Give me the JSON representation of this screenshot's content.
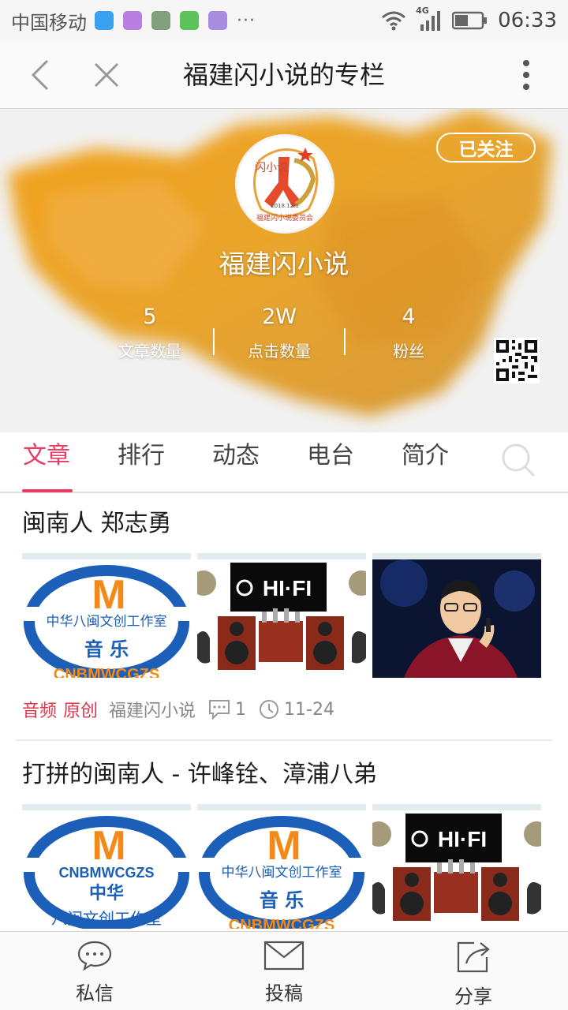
{
  "status_bar": {
    "carrier": "中国移动",
    "network": "4G",
    "time": "06:33",
    "more_indicator": "···",
    "icons": [
      "message-icon",
      "gallery-icon",
      "app-icon",
      "chat-icon",
      "notes-icon",
      "wifi-icon",
      "signal-icon",
      "battery-icon"
    ]
  },
  "nav": {
    "title": "福建闪小说的专栏"
  },
  "profile": {
    "follow_label": "已关注",
    "name": "福建闪小说",
    "logo_text": "福建闪小说委员会",
    "logo_date": "2018.12.1",
    "logo_script": "闪小说",
    "stats": [
      {
        "value": "5",
        "label": "文章数量"
      },
      {
        "value": "2W",
        "label": "点击数量"
      },
      {
        "value": "4",
        "label": "粉丝"
      }
    ]
  },
  "tabs": [
    {
      "label": "文章",
      "active": true
    },
    {
      "label": "排行",
      "active": false
    },
    {
      "label": "动态",
      "active": false
    },
    {
      "label": "电台",
      "active": false
    },
    {
      "label": "简介",
      "active": false
    }
  ],
  "articles": [
    {
      "title": "闽南人 郑志勇",
      "tag_type": "音频",
      "tag_origin": "原创",
      "author": "福建闪小说",
      "comments": "1",
      "date": "11-24",
      "thumbs": [
        "music-logo",
        "hifi",
        "singer"
      ]
    },
    {
      "title": "打拼的闽南人 - 许峰铨、漳浦八弟",
      "thumbs": [
        "music-logo-alt",
        "music-logo",
        "hifi"
      ]
    }
  ],
  "thumb_text": {
    "music_letter": "M",
    "studio": "中华八闽文创工作室",
    "music": "音 乐",
    "code": "CNBMWCGZS",
    "zhonghua": "中华",
    "bamin": "八闽文创工作室",
    "hifi": "HI·FI"
  },
  "bottom_bar": {
    "message": "私信",
    "submit": "投稿",
    "share": "分享"
  },
  "colors": {
    "accent": "#e83c64",
    "tag_red": "#e0344e",
    "logo_blue": "#1b5fb8",
    "logo_orange": "#f28a1a"
  }
}
